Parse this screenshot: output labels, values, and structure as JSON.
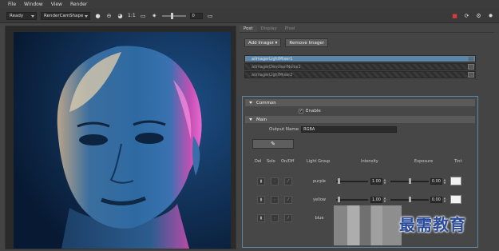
{
  "menu": [
    "File",
    "Window",
    "View",
    "Render"
  ],
  "toolbar": {
    "mode": "Ready",
    "camera": "RenderCamShape",
    "ratio": "1:1",
    "exposure": "0"
  },
  "tabs": [
    "Post",
    "Display",
    "Pixel"
  ],
  "buttons": {
    "add_imager": "Add Imager ▾",
    "remove_imager": "Remove Imager"
  },
  "imagers": [
    "aiImagerLightMixer1",
    "aiImagerDenoiserNoice1",
    "aiImagerLightMixer2"
  ],
  "sections": {
    "common": "Common",
    "main": "Main"
  },
  "enable_label": "Enable",
  "output_name_label": "Output Name",
  "output_name_value": "RGBA",
  "headers": {
    "del": "Del",
    "solo": "Solo",
    "onoff": "On/Off",
    "light_group": "Light Group",
    "intensity": "Intensity",
    "exposure": "Exposure",
    "tint": "Tint"
  },
  "light_groups": [
    {
      "name": "purple",
      "intensity": "1.00",
      "exposure": "0.00"
    },
    {
      "name": "yellow",
      "intensity": "1.00",
      "exposure": "0.00"
    },
    {
      "name": "blue",
      "intensity": "",
      "exposure": ""
    }
  ],
  "watermark": "最需教育",
  "colors": {
    "accent": "#5b86a8",
    "record": "#d63a3a"
  }
}
